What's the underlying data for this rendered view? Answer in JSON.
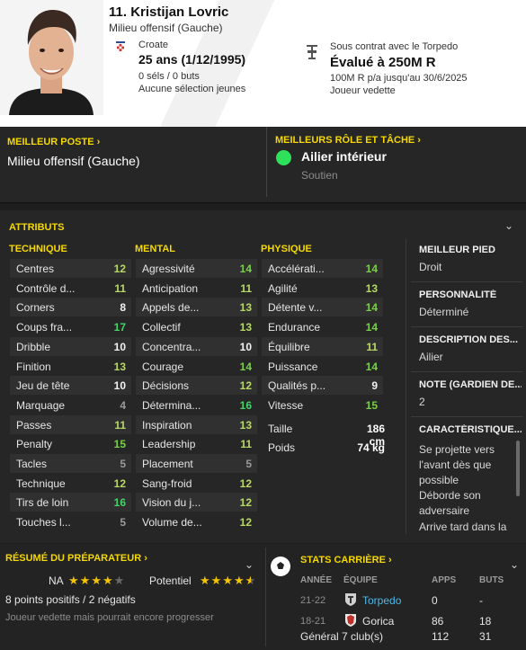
{
  "player": {
    "name": "11. Kristijan Lovric",
    "position": "Milieu offensif (Gauche)",
    "nationality": "Croate",
    "age": "25 ans (1/12/1995)",
    "selections": "0 séls / 0 buts",
    "youth": "Aucune sélection jeunes",
    "contract": "Sous contrat avec le Torpedo",
    "value": "Évalué à 250M R",
    "wage": "100M R p/a jusqu'au 30/6/2025",
    "status": "Joueur vedette"
  },
  "best_position": {
    "title": "MEILLEUR POSTE",
    "value": "Milieu offensif (Gauche)"
  },
  "best_role": {
    "title": "MEILLEURS RÔLE ET TÂCHE",
    "value": "Ailier intérieur",
    "duty": "Soutien"
  },
  "attributes": {
    "title": "ATTRIBUTS",
    "technique_title": "TECHNIQUE",
    "mental_title": "MENTAL",
    "physique_title": "PHYSIQUE",
    "technique": [
      {
        "name": "Centres",
        "value": "12",
        "tone": "v-green1"
      },
      {
        "name": "Contrôle d...",
        "value": "11",
        "tone": "v-green1"
      },
      {
        "name": "Corners",
        "value": "8",
        "tone": "v-white"
      },
      {
        "name": "Coups fra...",
        "value": "17",
        "tone": "v-green3"
      },
      {
        "name": "Dribble",
        "value": "10",
        "tone": "v-white"
      },
      {
        "name": "Finition",
        "value": "13",
        "tone": "v-green1"
      },
      {
        "name": "Jeu de tête",
        "value": "10",
        "tone": "v-white"
      },
      {
        "name": "Marquage",
        "value": "4",
        "tone": "v-grey"
      },
      {
        "name": "Passes",
        "value": "11",
        "tone": "v-green1"
      },
      {
        "name": "Penalty",
        "value": "15",
        "tone": "v-green2"
      },
      {
        "name": "Tacles",
        "value": "5",
        "tone": "v-grey"
      },
      {
        "name": "Technique",
        "value": "12",
        "tone": "v-green1"
      },
      {
        "name": "Tirs de loin",
        "value": "16",
        "tone": "v-green3"
      },
      {
        "name": "Touches l...",
        "value": "5",
        "tone": "v-grey"
      }
    ],
    "mental": [
      {
        "name": "Agressivité",
        "value": "14",
        "tone": "v-green2"
      },
      {
        "name": "Anticipation",
        "value": "11",
        "tone": "v-green1"
      },
      {
        "name": "Appels de...",
        "value": "13",
        "tone": "v-green1"
      },
      {
        "name": "Collectif",
        "value": "13",
        "tone": "v-green1"
      },
      {
        "name": "Concentra...",
        "value": "10",
        "tone": "v-white"
      },
      {
        "name": "Courage",
        "value": "14",
        "tone": "v-green2"
      },
      {
        "name": "Décisions",
        "value": "12",
        "tone": "v-green1"
      },
      {
        "name": "Détermina...",
        "value": "16",
        "tone": "v-green3"
      },
      {
        "name": "Inspiration",
        "value": "13",
        "tone": "v-green1"
      },
      {
        "name": "Leadership",
        "value": "11",
        "tone": "v-green1"
      },
      {
        "name": "Placement",
        "value": "5",
        "tone": "v-grey"
      },
      {
        "name": "Sang-froid",
        "value": "12",
        "tone": "v-green1"
      },
      {
        "name": "Vision du j...",
        "value": "12",
        "tone": "v-green1"
      },
      {
        "name": "Volume de...",
        "value": "12",
        "tone": "v-green1"
      }
    ],
    "physique": [
      {
        "name": "Accélérati...",
        "value": "14",
        "tone": "v-green2"
      },
      {
        "name": "Agilité",
        "value": "13",
        "tone": "v-green1"
      },
      {
        "name": "Détente v...",
        "value": "14",
        "tone": "v-green2"
      },
      {
        "name": "Endurance",
        "value": "14",
        "tone": "v-green2"
      },
      {
        "name": "Équilibre",
        "value": "11",
        "tone": "v-green1"
      },
      {
        "name": "Puissance",
        "value": "14",
        "tone": "v-green2"
      },
      {
        "name": "Qualités p...",
        "value": "9",
        "tone": "v-white"
      },
      {
        "name": "Vitesse",
        "value": "15",
        "tone": "v-green2"
      }
    ],
    "height_label": "Taille",
    "height": "186 cm",
    "weight_label": "Poids",
    "weight": "74 kg"
  },
  "sidebar": {
    "foot_title": "MEILLEUR PIED",
    "foot": "Droit",
    "personality_title": "PERSONNALITÉ",
    "personality": "Déterminé",
    "media_title": "DESCRIPTION DES...",
    "media": "Ailier",
    "gk_title": "NOTE (GARDIEN DE...",
    "gk": "2",
    "traits_title": "CARACTÉRISTIQUE...",
    "traits": [
      "Se projette vers l'avant dès que possible",
      "Déborde son adversaire",
      "Arrive tard dans la"
    ]
  },
  "scout": {
    "title": "RÉSUMÉ DU PRÉPARATEUR",
    "ca_label": "NA",
    "ca_stars": 4,
    "pa_label": "Potentiel",
    "pa_stars": 4.5,
    "points": "8 points positifs / 2 négatifs",
    "note": "Joueur vedette mais pourrait encore progresser"
  },
  "career": {
    "title": "STATS CARRIÈRE",
    "headers": {
      "season": "ANNÉE",
      "team": "ÉQUIPE",
      "apps": "APPS",
      "goals": "BUTS"
    },
    "rows": [
      {
        "season": "21-22",
        "team": "Torpedo",
        "apps": "0",
        "goals": "-"
      },
      {
        "season": "18-21",
        "team": "Gorica",
        "apps": "86",
        "goals": "18"
      }
    ],
    "total": {
      "label": "Général 7 club(s)",
      "apps": "112",
      "goals": "31"
    }
  },
  "colors": {
    "accent": "#f5d800",
    "role_dot": "#2ee05a",
    "link": "#4fb8e8"
  }
}
